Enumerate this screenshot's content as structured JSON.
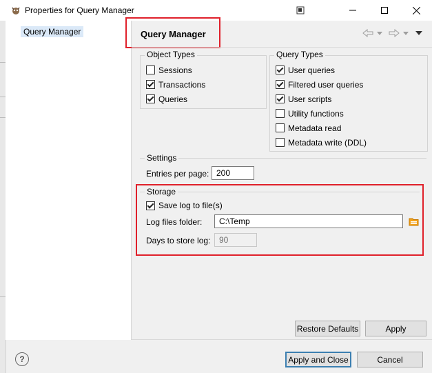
{
  "window": {
    "title": "Properties for Query Manager"
  },
  "tree": {
    "items": [
      {
        "label": "Query Manager"
      }
    ]
  },
  "page": {
    "title": "Query Manager"
  },
  "object_types": {
    "label": "Object Types",
    "items": [
      {
        "label": "Sessions",
        "checked": false
      },
      {
        "label": "Transactions",
        "checked": true
      },
      {
        "label": "Queries",
        "checked": true
      }
    ]
  },
  "query_types": {
    "label": "Query Types",
    "items": [
      {
        "label": "User queries",
        "checked": true
      },
      {
        "label": "Filtered user queries",
        "checked": true
      },
      {
        "label": "User scripts",
        "checked": true
      },
      {
        "label": "Utility functions",
        "checked": false
      },
      {
        "label": "Metadata read",
        "checked": false
      },
      {
        "label": "Metadata write (DDL)",
        "checked": false
      }
    ]
  },
  "settings": {
    "label": "Settings",
    "entries_label": "Entries per page:",
    "entries_value": "200"
  },
  "storage": {
    "label": "Storage",
    "save_log_label": "Save log to file(s)",
    "save_log_checked": true,
    "folder_label": "Log files folder:",
    "folder_value": "C:\\Temp",
    "days_label": "Days to store log:",
    "days_value": "90"
  },
  "buttons": {
    "restore_defaults": "Restore Defaults",
    "apply": "Apply",
    "apply_and_close": "Apply and Close",
    "cancel": "Cancel"
  },
  "help": {
    "symbol": "?"
  },
  "colors": {
    "highlight_border": "#e0202a",
    "selection": "#dbe9f8",
    "default_button_border": "#3c7fb1"
  }
}
